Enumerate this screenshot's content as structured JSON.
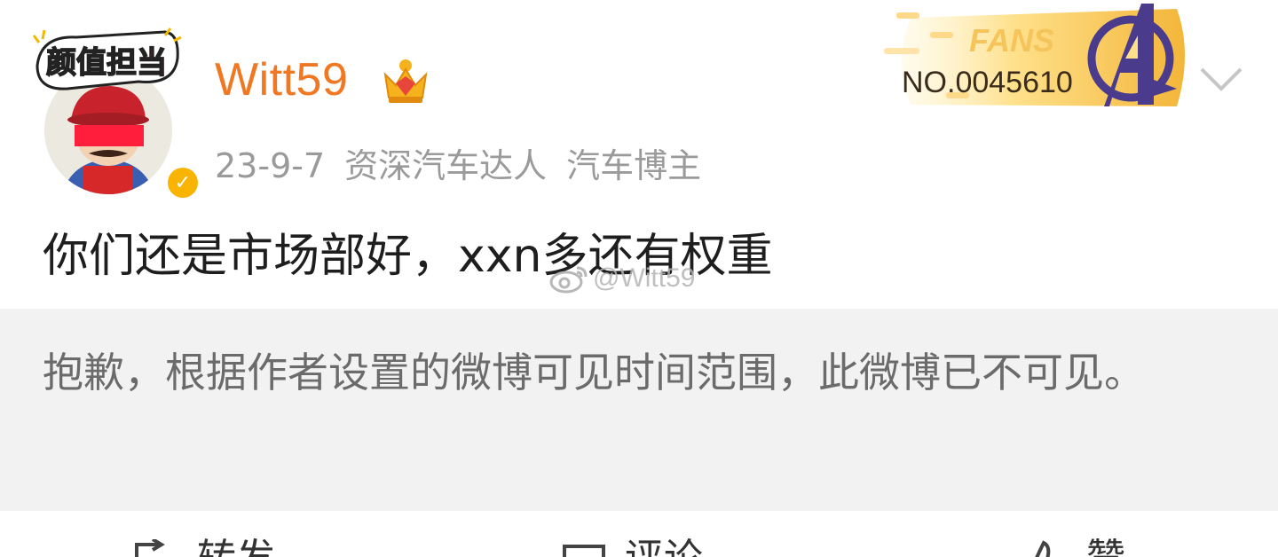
{
  "post": {
    "avatar_sticker_text": "颜值担当",
    "username": "Witt59",
    "date": "23-9-7",
    "tags": [
      "资深汽车达人",
      "汽车博主"
    ],
    "fans_badge": {
      "label": "FANS",
      "number": "NO.0045610"
    },
    "text": "你们还是市场部好，xxn多还有权重",
    "watermark": "@Witt59"
  },
  "notice": {
    "text": "抱歉，根据作者设置的微博可见时间范围，此微博已不可见。"
  },
  "actions": [
    {
      "label": "转发",
      "icon": "repost-icon"
    },
    {
      "label": "评论",
      "icon": "comment-icon"
    },
    {
      "label": "赞",
      "icon": "like-icon"
    }
  ],
  "colors": {
    "username": "#f07823",
    "meta": "#9a9a9a",
    "notice_bg": "#f2f2f2",
    "verified": "#f8b400"
  }
}
